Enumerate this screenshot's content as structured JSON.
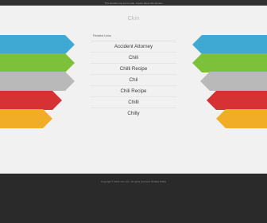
{
  "topbar": {
    "text": "This domain may be for sale. Inquire about this domain"
  },
  "domain": "Ckin",
  "related_title": "Related Links",
  "links": [
    {
      "label": "Accident Attorney"
    },
    {
      "label": "Chili"
    },
    {
      "label": "Chilli Recipe"
    },
    {
      "label": "Chil"
    },
    {
      "label": "Chili Recipe"
    },
    {
      "label": "Chilli"
    },
    {
      "label": "Chilly"
    }
  ],
  "colors": {
    "blue": "#3fa9d4",
    "green": "#7dc13a",
    "gray": "#b9b9b9",
    "red": "#d63233",
    "orange": "#f0ad25"
  },
  "footer": {
    "prefix": "Copyright © 2024 ckin.com. All rights reserved.",
    "link": "Privacy Policy"
  }
}
